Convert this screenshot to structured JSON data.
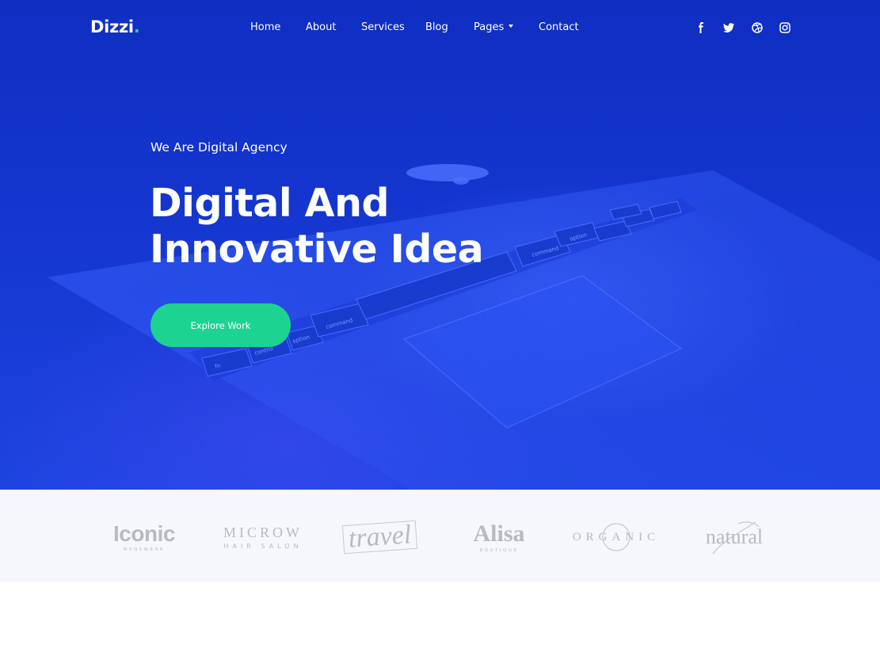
{
  "nav": {
    "logo_text": "Dizzi",
    "logo_dot": ".",
    "items": [
      {
        "label": "Home"
      },
      {
        "label": "About"
      },
      {
        "label": "Services"
      },
      {
        "label": "Blog"
      },
      {
        "label": "Pages",
        "has_dropdown": true
      },
      {
        "label": "Contact"
      }
    ],
    "social_icons": [
      "facebook-icon",
      "twitter-icon",
      "dribbble-icon",
      "instagram-icon"
    ]
  },
  "hero": {
    "subtitle": "We Are Digital Agency",
    "title_line1": "Digital And",
    "title_line2": "Innovative Idea",
    "cta_label": "Explore Work",
    "keyboard_labels": [
      "fn",
      "control",
      "option",
      "command",
      "command",
      "option"
    ]
  },
  "brands": [
    {
      "name": "Iconic",
      "tagline": "MENSWEAR"
    },
    {
      "name": "MICROW",
      "tagline": "HAIR SALON"
    },
    {
      "name": "travel"
    },
    {
      "name": "Alisa",
      "tagline": "BOUTIQUE"
    },
    {
      "name": "ORGANIC"
    },
    {
      "name": "natural"
    }
  ],
  "colors": {
    "hero_blue": "#1536cf",
    "accent_green": "#1dd391",
    "logo_dot": "#1fd28e",
    "brand_grey": "#b9babd",
    "brands_bg": "#f6f7fb"
  }
}
